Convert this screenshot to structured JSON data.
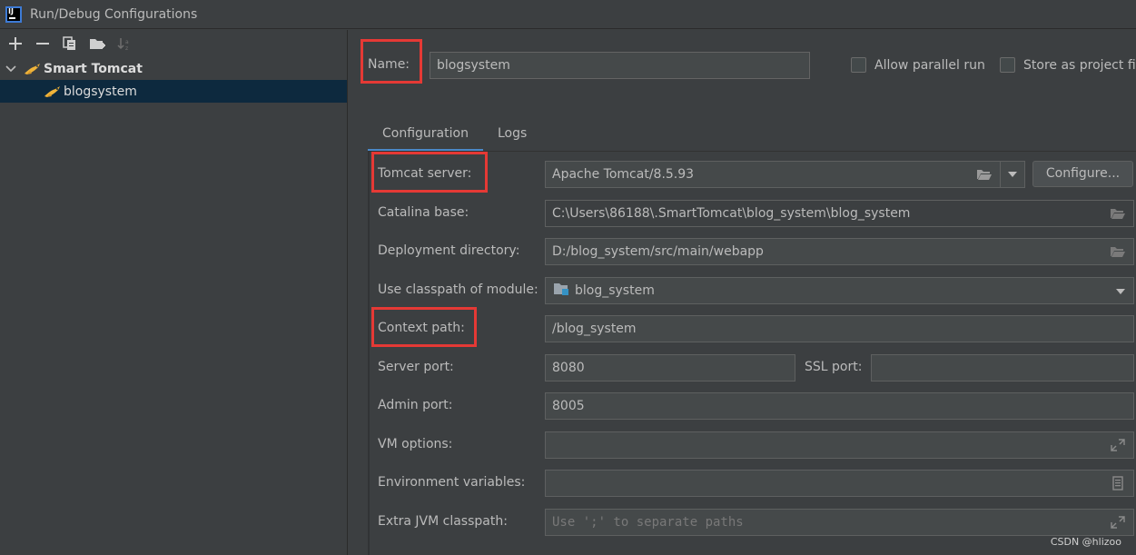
{
  "window": {
    "title": "Run/Debug Configurations"
  },
  "toolbar": {
    "add_icon": "plus-icon",
    "remove_icon": "minus-icon",
    "copy_icon": "copy-icon",
    "folder_icon": "new-folder-icon",
    "sort_icon": "sort-icon"
  },
  "tree": {
    "group_label": "Smart Tomcat",
    "child_label": "blogsystem"
  },
  "form": {
    "name_label": "Name:",
    "name_value": "blogsystem",
    "allow_parallel_label": "Allow parallel run",
    "store_as_file_label": "Store as project file",
    "tabs": [
      {
        "label": "Configuration",
        "active": true
      },
      {
        "label": "Logs",
        "active": false
      }
    ],
    "tomcat_server_label": "Tomcat server:",
    "tomcat_server_value": "Apache Tomcat/8.5.93",
    "configure_label": "Configure...",
    "catalina_base_label": "Catalina base:",
    "catalina_base_value": "C:\\Users\\86188\\.SmartTomcat\\blog_system\\blog_system",
    "deployment_dir_label": "Deployment directory:",
    "deployment_dir_value": "D:/blog_system/src/main/webapp",
    "classpath_module_label": "Use classpath of module:",
    "classpath_module_value": "blog_system",
    "context_path_label": "Context path:",
    "context_path_value": "/blog_system",
    "server_port_label": "Server port:",
    "server_port_value": "8080",
    "ssl_port_label": "SSL port:",
    "ssl_port_value": "",
    "admin_port_label": "Admin port:",
    "admin_port_value": "8005",
    "vm_options_label": "VM options:",
    "vm_options_value": "",
    "env_vars_label": "Environment variables:",
    "env_vars_value": "",
    "extra_jvm_label": "Extra JVM classpath:",
    "extra_jvm_placeholder": "Use ';' to separate paths"
  },
  "watermark": "CSDN @hlizoo",
  "colors": {
    "background": "#3c3f41",
    "selection": "#0d293e",
    "accent_tab": "#4a88c7",
    "highlight": "#e53935"
  }
}
